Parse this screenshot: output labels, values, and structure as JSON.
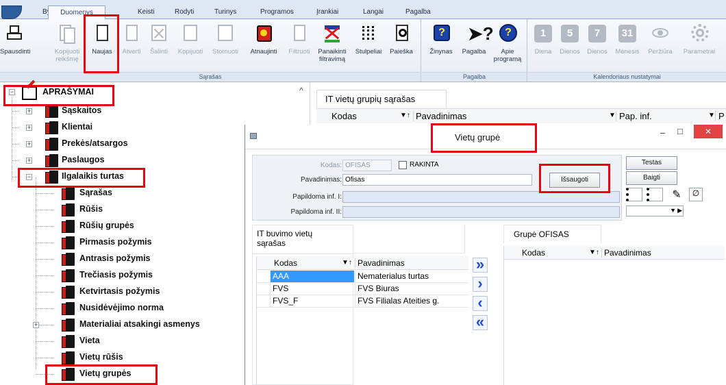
{
  "app": {
    "menu_tabs": [
      "Byla",
      "Duomenys",
      "Keisti",
      "Rodyti",
      "Turinys",
      "Programos",
      "Įrankiai",
      "Langai",
      "Pagalba"
    ],
    "active_tab": "Duomenys"
  },
  "ribbon": {
    "groups": {
      "sarasas": "Sąrašas",
      "pagalba": "Pagalba",
      "kalendorius": "Kalendoriaus nustatymai"
    },
    "buttons": {
      "spausdinti": "Spausdinti",
      "kopijuoti_reiksme_1": "Kopijuoti",
      "kopijuoti_reiksme_2": "reikšmę",
      "naujas": "Naujas",
      "atverti": "Atverti",
      "salinti": "Šalinti",
      "kopijuoti": "Kopijuoti",
      "stornuoti": "Stornuoti",
      "atnaujinti": "Atnaujinti",
      "filtruoti": "Filtruoti",
      "panaikinti_1": "Panaikinti",
      "panaikinti_2": "filtravimą",
      "stulpeliai": "Stulpeliai",
      "paieska": "Paieška",
      "zinynas": "Žinynas",
      "pagalba": "Pagalba",
      "apie_1": "Apie",
      "apie_2": "programą",
      "diena": "Diena",
      "dienos1": "Dienos",
      "dienos2": "Dienos",
      "menesis": "Mėnesis",
      "perziura": "Peržiūra",
      "parametrai": "Parametrai"
    },
    "tiles": [
      "1",
      "5",
      "7",
      "31"
    ]
  },
  "tree": {
    "root": "APRAŠYMAI",
    "items": [
      {
        "label": "Sąskaitos"
      },
      {
        "label": "Klientai"
      },
      {
        "label": "Prekės/atsargos"
      },
      {
        "label": "Paslaugos"
      },
      {
        "label": "Ilgalaikis turtas"
      }
    ],
    "children": [
      {
        "label": "Sąrašas"
      },
      {
        "label": "Rūšis"
      },
      {
        "label": "Rūšių grupės"
      },
      {
        "label": "Pirmasis požymis"
      },
      {
        "label": "Antrasis požymis"
      },
      {
        "label": "Trečiasis požymis"
      },
      {
        "label": "Ketvirtasis požymis"
      },
      {
        "label": "Nusidėvėjimo norma"
      },
      {
        "label": "Materialiai atsakingi asmenys"
      },
      {
        "label": "Vieta"
      },
      {
        "label": "Vietų rūšis"
      },
      {
        "label": "Vietų grupės"
      }
    ],
    "scroll_up": "^"
  },
  "list_header": {
    "tab": "IT vietų grupių sąrašas",
    "columns": [
      "Kodas",
      "Pavadinimas",
      "Pap. inf.",
      "P"
    ],
    "sort_mark": "▼↑",
    "dropdown_mark": "▼"
  },
  "dialog": {
    "title": "Vietų grupė",
    "controls": {
      "minimize": "–",
      "maximize": "□",
      "close": "✕"
    },
    "form": {
      "kodas_label": "Kodas:",
      "kodas_value": "OFISAS",
      "rakinta_label": "RAKINTA",
      "pavadinimas_label": "Pavadinimas:",
      "pavadinimas_value": "Ofisas",
      "papildoma1_label": "Papildoma inf. I:",
      "papildoma1_value": "",
      "papildoma2_label": "Papildoma inf. II:",
      "papildoma2_value": ""
    },
    "buttons": {
      "issaugoti": "Išsaugoti",
      "testas": "Testas",
      "baigti": "Baigti"
    },
    "left_list": {
      "title_1": "IT buvimo vietų",
      "title_2": "sąrašas",
      "columns": [
        "Kodas",
        "Pavadinimas"
      ],
      "rows": [
        {
          "kodas": "AAA",
          "pavadinimas": "Nematerialus turtas"
        },
        {
          "kodas": "FVS",
          "pavadinimas": "FVS Biuras"
        },
        {
          "kodas": "FVS_F",
          "pavadinimas": "FVS Filialas Ateities g."
        }
      ]
    },
    "arrows": [
      "»",
      "›",
      "‹",
      "«"
    ],
    "right_list": {
      "title": "Grupė OFISAS",
      "columns": [
        "Kodas",
        "Pavadinimas"
      ]
    }
  },
  "colors": {
    "highlight": "#e30613",
    "selected_row": "#3399ff",
    "ribbon_tile": "#b3bac4"
  }
}
